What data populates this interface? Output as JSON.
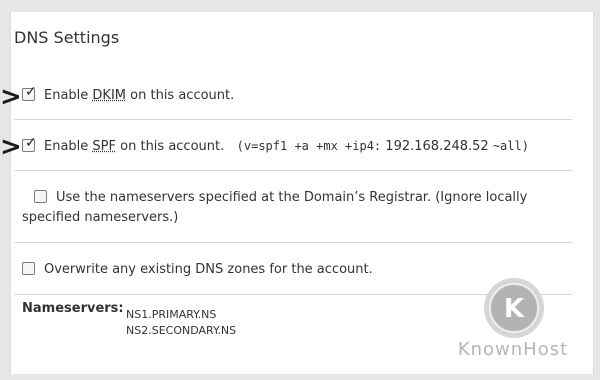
{
  "section": {
    "title": "DNS Settings"
  },
  "options": {
    "dkim": {
      "checked": true,
      "prefix": "Enable",
      "abbr": "DKIM",
      "suffix": "on this account."
    },
    "spf": {
      "checked": true,
      "prefix": "Enable",
      "abbr": "SPF",
      "suffix": "on this account.",
      "record": "(v=spf1 +a +mx +ip4:",
      "ip": "192.168.248.52",
      "tail": "~all)"
    },
    "registrar_ns": {
      "checked": false,
      "line1": "Use the nameservers specified at the Domain’s Registrar. (Ignore locally",
      "line2": "specified nameservers.)"
    },
    "overwrite_zones": {
      "checked": false,
      "label": "Overwrite any existing DNS zones for the account."
    }
  },
  "nameservers": {
    "label": "Nameservers:",
    "list": [
      "NS1.PRIMARY.NS",
      "NS2.SECONDARY.NS"
    ]
  },
  "annotations": {
    "marker": ">"
  },
  "logo": {
    "glyph": "K",
    "text": "KnownHost"
  },
  "colors": {
    "background": "#e6e6e6",
    "panel": "#ffffff",
    "text": "#333333",
    "separator": "#d8d8d8",
    "logo": "#b5b5b5"
  }
}
